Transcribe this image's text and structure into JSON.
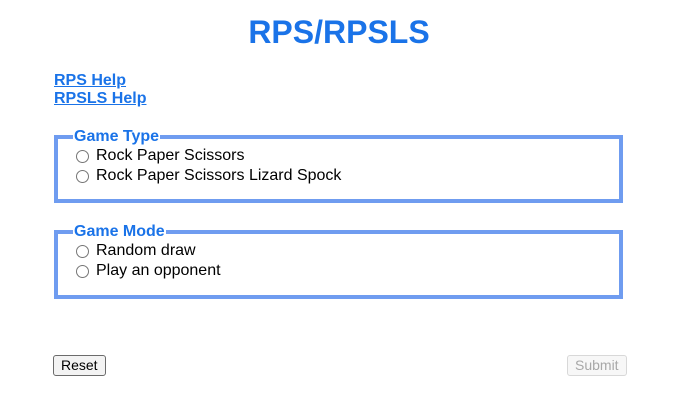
{
  "page": {
    "title": "RPS/RPSLS"
  },
  "help": {
    "rps": "RPS Help",
    "rpsls": "RPSLS Help"
  },
  "game_type": {
    "legend": "Game Type",
    "options": [
      {
        "label": "Rock Paper Scissors",
        "checked": false
      },
      {
        "label": "Rock Paper Scissors Lizard Spock",
        "checked": false
      }
    ]
  },
  "game_mode": {
    "legend": "Game Mode",
    "options": [
      {
        "label": "Random draw",
        "checked": false
      },
      {
        "label": "Play an opponent",
        "checked": false
      }
    ]
  },
  "actions": {
    "reset": "Reset",
    "submit": "Submit",
    "submit_disabled": true
  },
  "colors": {
    "accent": "#1a73e8",
    "fieldset_border": "#6f9cf0"
  }
}
